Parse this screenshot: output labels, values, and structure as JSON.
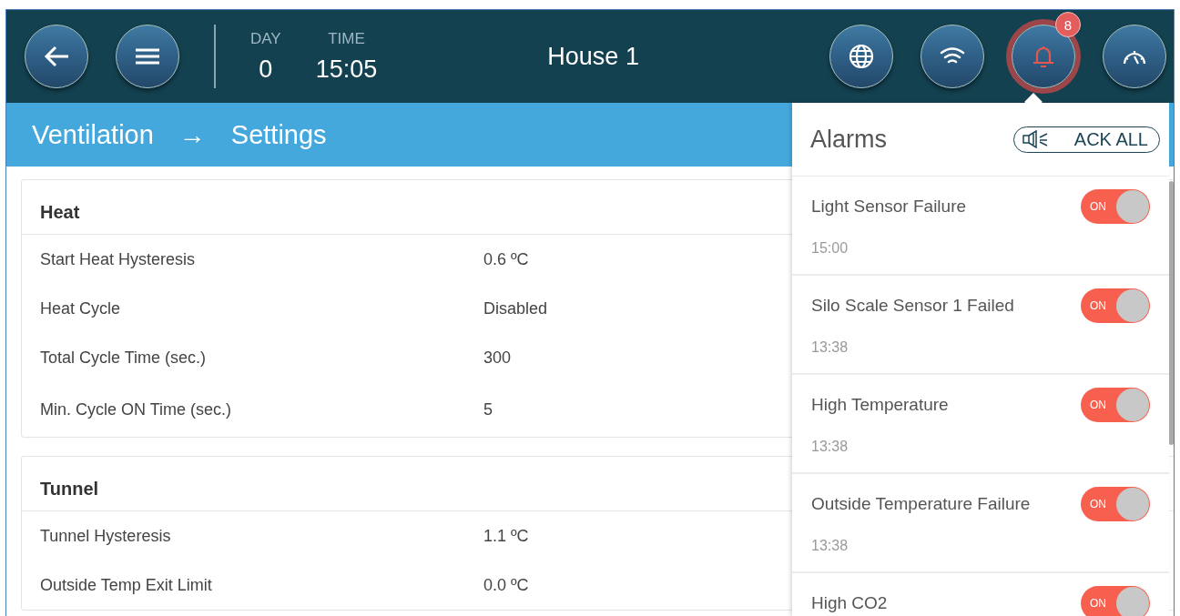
{
  "header": {
    "day_label": "DAY",
    "day": "0",
    "time_label": "TIME",
    "time": "15:05",
    "title": "House 1",
    "alarm_count": "8",
    "alarms_open": true
  },
  "breadcrumb": {
    "section": "Ventilation",
    "arrow": "→",
    "page": "Settings"
  },
  "cards": [
    {
      "title": "Heat",
      "rows": [
        {
          "label": "Start Heat Hysteresis",
          "value": "0.6 ºC"
        },
        {
          "label": "Heat Cycle",
          "value": "Disabled"
        },
        {
          "label": "Total Cycle Time (sec.)",
          "value": "300"
        },
        {
          "label": "Min. Cycle ON Time (sec.)",
          "value": "5"
        }
      ]
    },
    {
      "title": "Tunnel",
      "rows": [
        {
          "label": "Tunnel Hysteresis",
          "value": "1.1 ºC"
        },
        {
          "label": "Outside Temp Exit Limit",
          "value": "0.0 ºC"
        }
      ]
    }
  ],
  "alarms_panel": {
    "title": "Alarms",
    "ack_button": "ACK ALL",
    "items": [
      {
        "name": "Light Sensor Failure",
        "time": "15:00",
        "on": true,
        "toggle_label": "ON"
      },
      {
        "name": "Silo Scale Sensor 1 Failed",
        "time": "13:38",
        "on": true,
        "toggle_label": "ON"
      },
      {
        "name": "High Temperature",
        "time": "13:38",
        "on": true,
        "toggle_label": "ON"
      },
      {
        "name": "Outside Temperature Failure",
        "time": "13:38",
        "on": true,
        "toggle_label": "ON"
      },
      {
        "name": "High CO2",
        "on": true,
        "toggle_label": "ON"
      }
    ]
  }
}
